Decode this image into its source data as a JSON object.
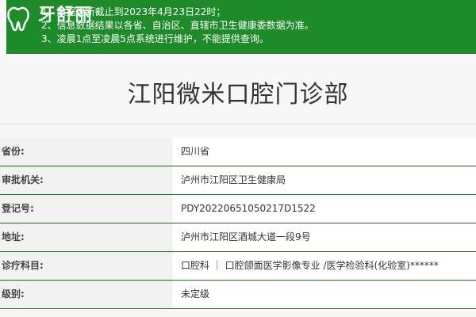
{
  "notice": {
    "lines": [
      "1、数据更新截止到2023年4月23日22时；",
      "2、信息数据结果以各省、自治区、直辖市卫生健康委数据为准。",
      "3、凌晨1点至凌晨5点系统进行维护，不能提供查询。"
    ],
    "background_color": "#1e8a2a"
  },
  "logo": {
    "text": "牙舒丽",
    "icon": "tooth-icon"
  },
  "page": {
    "title": "江阳微米口腔门诊部"
  },
  "info_rows": [
    {
      "label": "省份:",
      "value": "四川省"
    },
    {
      "label": "审批机关:",
      "value": "泸州市江阳区卫生健康局"
    },
    {
      "label": "登记号:",
      "value": "PDY20220651050217D1522"
    },
    {
      "label": "地址:",
      "value": "泸州市江阳区酒城大道一段9号"
    },
    {
      "label": "诊疗科目:",
      "value": "口腔科 ｜ 口腔颌面医学影像专业 /医学检验科(化验室)******"
    },
    {
      "label": "级别:",
      "value": "未定级"
    }
  ],
  "colors": {
    "accent_green": "#1e8a2a",
    "row_divider": "#1e6b2a"
  }
}
